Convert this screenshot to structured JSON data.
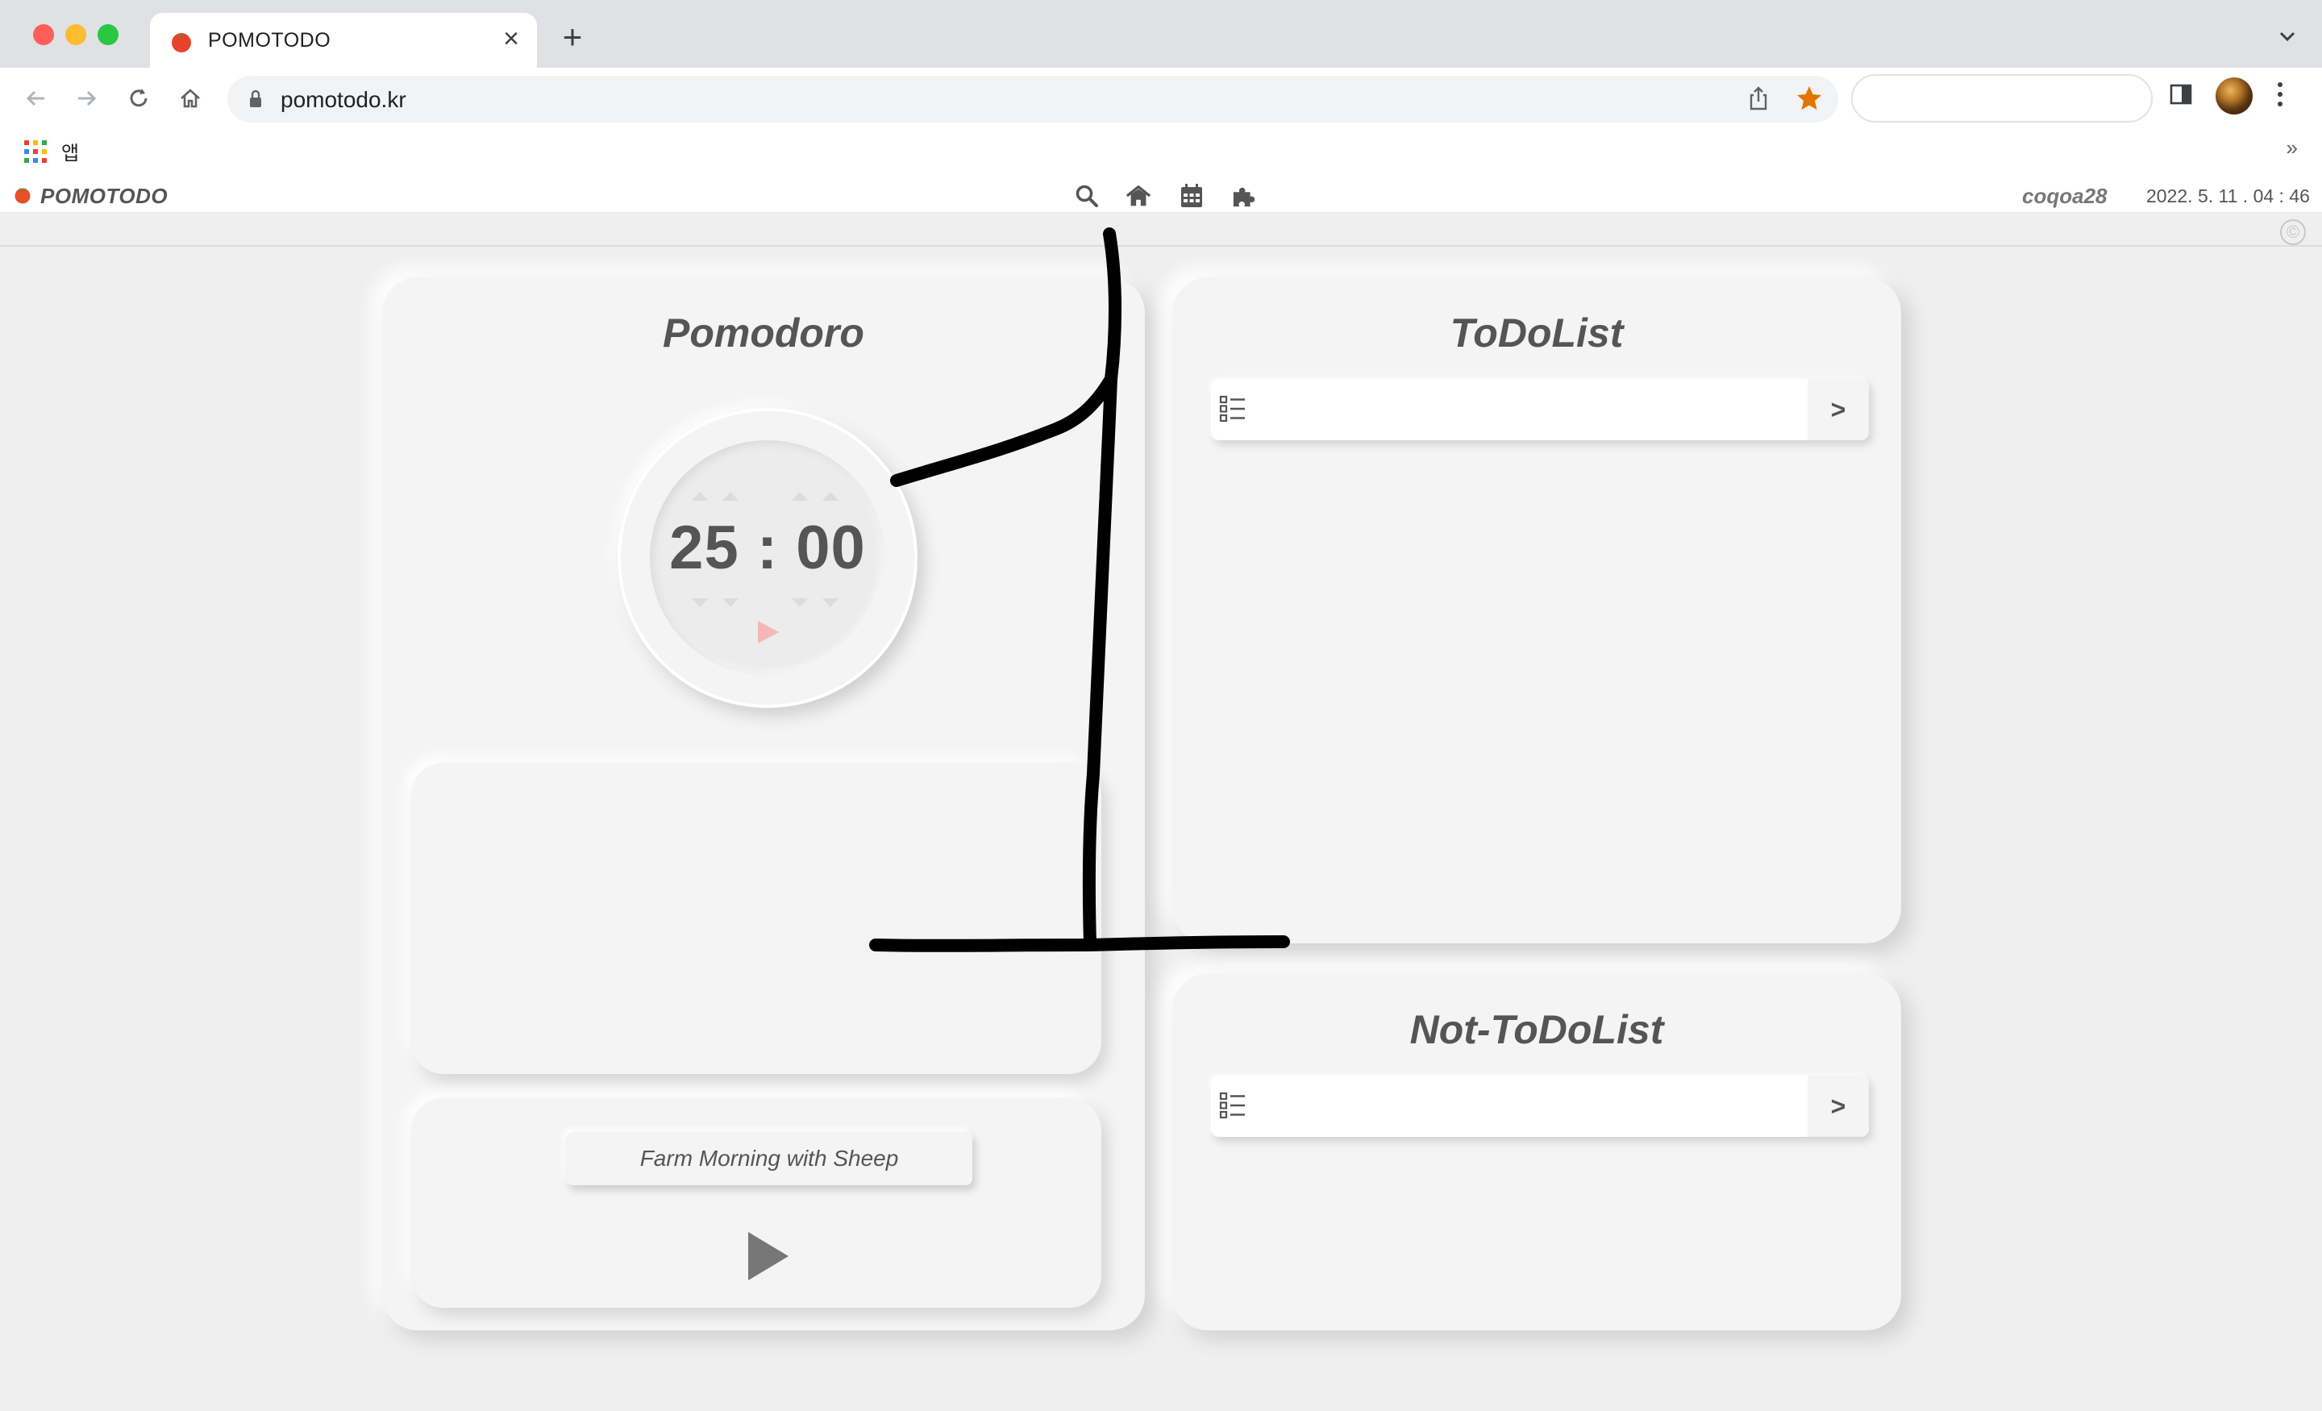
{
  "browser": {
    "tab_title": "POMOTODO",
    "new_tab_symbol": "+",
    "close_symbol": "×",
    "url": "pomotodo.kr",
    "bookmark_apps_label": "앱",
    "bookmarks_more": "»"
  },
  "header": {
    "brand": "POMOTODO",
    "icons": [
      "search-icon",
      "home-icon",
      "calendar-icon",
      "puzzle-icon"
    ],
    "user": "coqoa28",
    "datetime": "2022. 5. 11 . 04 : 46",
    "copyright_symbol": "©"
  },
  "pomodoro": {
    "title": "Pomodoro",
    "minutes": "25",
    "separator": ":",
    "seconds": "00",
    "music_title": "Farm Morning with Sheep"
  },
  "todo": {
    "title": "ToDoList",
    "submit_label": ">",
    "input_value": ""
  },
  "not_todo": {
    "title": "Not-ToDoList",
    "submit_label": ">",
    "input_value": ""
  },
  "colors": {
    "background": "#efefef",
    "card": "#f4f4f4",
    "text": "#555555",
    "timer_play": "#f4b6b6",
    "star": "#e37400",
    "scribble": "#000000"
  }
}
